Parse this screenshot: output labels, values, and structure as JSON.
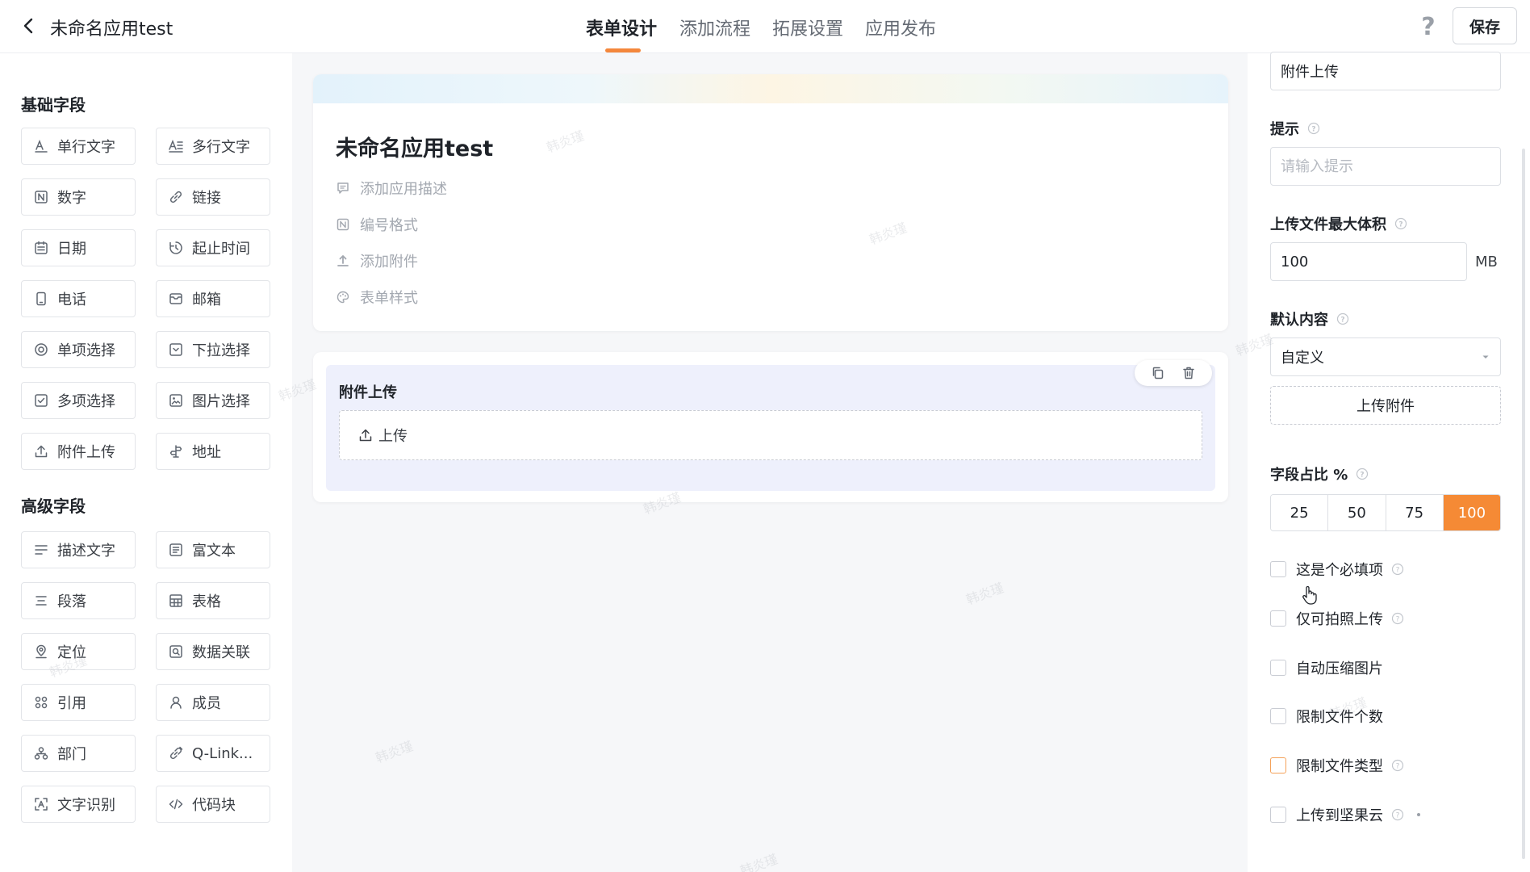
{
  "header": {
    "app_title": "未命名应用test",
    "tabs": [
      {
        "label": "表单设计",
        "active": true
      },
      {
        "label": "添加流程",
        "active": false
      },
      {
        "label": "拓展设置",
        "active": false
      },
      {
        "label": "应用发布",
        "active": false
      }
    ],
    "save_label": "保存",
    "accent_color": "#f4873c"
  },
  "palette": {
    "basic_title": "基础字段",
    "basic_fields": [
      {
        "label": "单行文字",
        "icon": "text-single-icon"
      },
      {
        "label": "多行文字",
        "icon": "text-multi-icon"
      },
      {
        "label": "数字",
        "icon": "number-icon"
      },
      {
        "label": "链接",
        "icon": "link-icon"
      },
      {
        "label": "日期",
        "icon": "calendar-icon"
      },
      {
        "label": "起止时间",
        "icon": "time-range-icon"
      },
      {
        "label": "电话",
        "icon": "phone-icon"
      },
      {
        "label": "邮箱",
        "icon": "mail-icon"
      },
      {
        "label": "单项选择",
        "icon": "radio-icon"
      },
      {
        "label": "下拉选择",
        "icon": "dropdown-icon"
      },
      {
        "label": "多项选择",
        "icon": "checkbox-icon"
      },
      {
        "label": "图片选择",
        "icon": "image-icon"
      },
      {
        "label": "附件上传",
        "icon": "upload-icon"
      },
      {
        "label": "地址",
        "icon": "signpost-icon"
      }
    ],
    "advanced_title": "高级字段",
    "advanced_fields": [
      {
        "label": "描述文字",
        "icon": "description-icon"
      },
      {
        "label": "富文本",
        "icon": "rich-text-icon"
      },
      {
        "label": "段落",
        "icon": "paragraph-icon"
      },
      {
        "label": "表格",
        "icon": "table-icon"
      },
      {
        "label": "定位",
        "icon": "location-icon"
      },
      {
        "label": "数据关联",
        "icon": "data-link-icon"
      },
      {
        "label": "引用",
        "icon": "reference-icon"
      },
      {
        "label": "成员",
        "icon": "member-icon"
      },
      {
        "label": "部门",
        "icon": "department-icon"
      },
      {
        "label": "Q-Link...",
        "icon": "qlink-icon"
      },
      {
        "label": "文字识别",
        "icon": "ocr-icon"
      },
      {
        "label": "代码块",
        "icon": "code-icon"
      }
    ]
  },
  "canvas": {
    "form_title": "未命名应用test",
    "meta_items": [
      {
        "label": "添加应用描述",
        "icon": "comment-icon"
      },
      {
        "label": "编号格式",
        "icon": "number-format-icon"
      },
      {
        "label": "添加附件",
        "icon": "attach-upload-icon"
      },
      {
        "label": "表单样式",
        "icon": "palette-icon"
      }
    ],
    "selected_field": {
      "label": "附件上传",
      "upload_label": "上传"
    }
  },
  "props": {
    "title_value": "附件上传",
    "hint_label": "提示",
    "hint_placeholder": "请输入提示",
    "max_size_label": "上传文件最大体积",
    "max_size_value": "100",
    "max_size_unit": "MB",
    "default_label": "默认内容",
    "default_value": "自定义",
    "upload_attachment_label": "上传附件",
    "ratio_label": "字段占比 %",
    "ratio_options": [
      "25",
      "50",
      "75",
      "100"
    ],
    "ratio_selected": "100",
    "checkboxes": [
      {
        "label": "这是个必填项",
        "help": true
      },
      {
        "label": "仅可拍照上传",
        "help": true
      },
      {
        "label": "自动压缩图片",
        "help": false
      },
      {
        "label": "限制文件个数",
        "help": false
      },
      {
        "label": "限制文件类型",
        "help": true
      },
      {
        "label": "上传到坚果云",
        "help": true
      }
    ]
  },
  "watermark_text": "韩炎瑾"
}
